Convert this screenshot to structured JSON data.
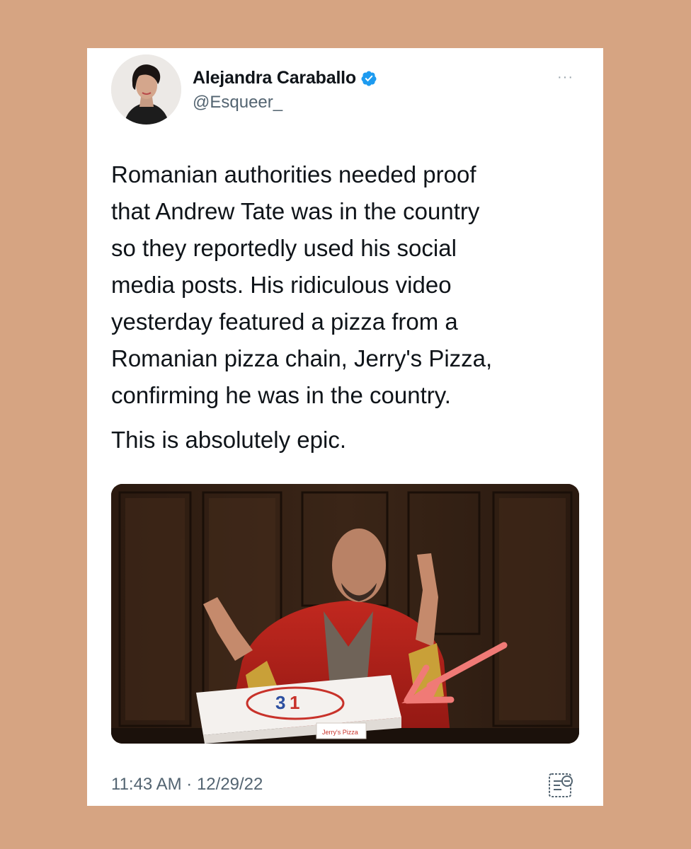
{
  "tweet": {
    "author": {
      "display_name": "Alejandra Caraballo",
      "handle": "@Esqueer_",
      "verified": true,
      "avatar_icon": "profile-photo"
    },
    "more_label": "···",
    "text_paragraph_1": "Romanian authorities needed proof\nthat Andrew Tate was in the country\nso they reportedly used his social\nmedia posts. His ridiculous video\nyesterday featured a pizza from a\nRomanian pizza chain, Jerry's Pizza,\nconfirming he was in the country.",
    "text_paragraph_2": "This is absolutely epic.",
    "media": {
      "box_text": "Jerry's Pizza"
    },
    "timestamp": "11:43 AM · 12/29/22",
    "analytics_icon": "analytics-icon"
  },
  "colors": {
    "background": "#d6a482",
    "card": "#ffffff",
    "verified": "#1d9bf0",
    "text": "#0f1419",
    "secondary_text": "#536471",
    "arrow": "#f07a76"
  }
}
